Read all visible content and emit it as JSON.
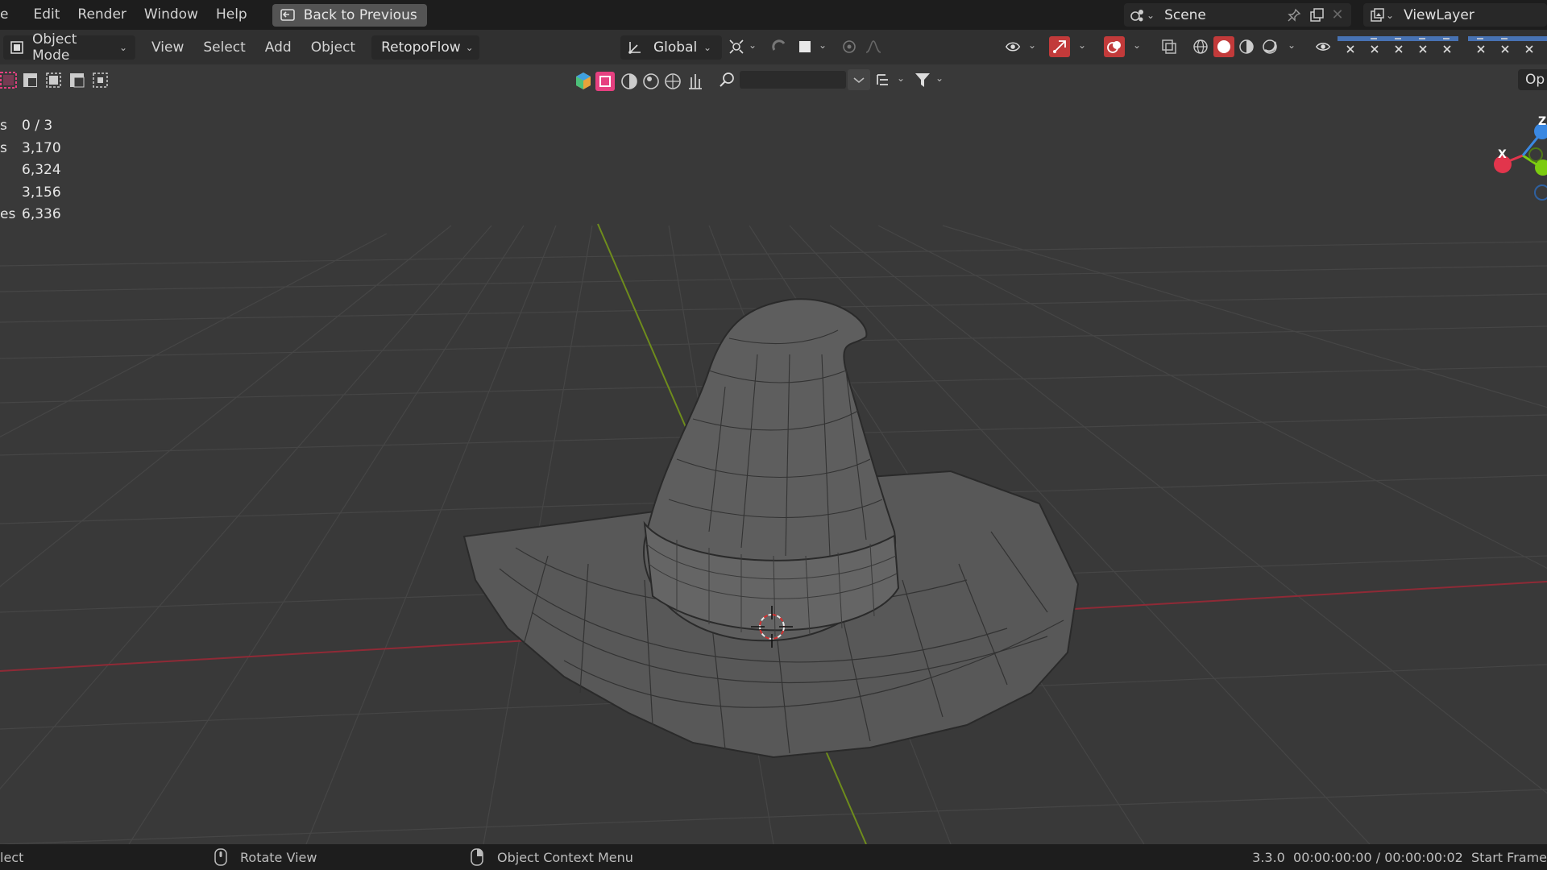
{
  "topbar": {
    "menus": [
      "e",
      "Edit",
      "Render",
      "Window",
      "Help"
    ],
    "back_label": "Back to Previous",
    "scene_name": "Scene",
    "view_layer_name": "ViewLayer"
  },
  "header": {
    "mode_label": "Object Mode",
    "menus": [
      "View",
      "Select",
      "Add",
      "Object"
    ],
    "addon_menu": "RetopoFlow",
    "transform_orientation": "Global"
  },
  "header2": {
    "right_label": "Op"
  },
  "stats": [
    {
      "label": "s",
      "value": "0 / 3"
    },
    {
      "label": "s",
      "value": "3,170"
    },
    {
      "label": "",
      "value": "6,324"
    },
    {
      "label": "",
      "value": "3,156"
    },
    {
      "label": "es",
      "value": "6,336"
    }
  ],
  "gizmo": {
    "x": "X",
    "z": "Z"
  },
  "statusbar": {
    "left": "lect",
    "rotate": "Rotate View",
    "context": "Object Context Menu",
    "right": "3.3.0  00:00:00:00 / 00:00:00:02  Start Frame"
  },
  "colors": {
    "accent_select": "#e64080",
    "x_axis": "#8f2a36",
    "y_axis": "#6e8c1c",
    "gizmo_x": "#e2354c",
    "gizmo_y": "#7ccc10",
    "gizmo_z": "#3a88e2"
  }
}
